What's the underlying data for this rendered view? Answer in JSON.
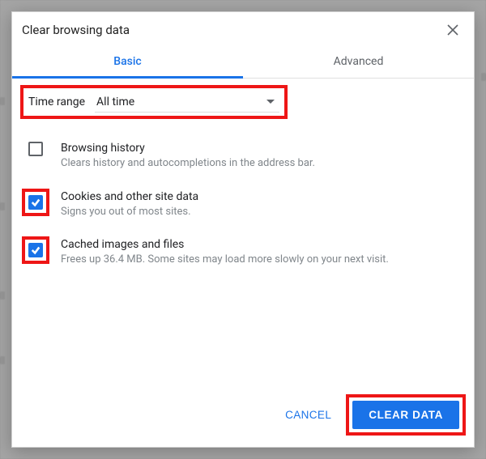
{
  "dialog": {
    "title": "Clear browsing data",
    "tabs": {
      "basic": "Basic",
      "advanced": "Advanced"
    },
    "time_range": {
      "label": "Time range",
      "value": "All time"
    },
    "options": [
      {
        "title": "Browsing history",
        "desc": "Clears history and autocompletions in the address bar.",
        "checked": false,
        "highlighted": false
      },
      {
        "title": "Cookies and other site data",
        "desc": "Signs you out of most sites.",
        "checked": true,
        "highlighted": true
      },
      {
        "title": "Cached images and files",
        "desc": "Frees up 36.4 MB. Some sites may load more slowly on your next visit.",
        "checked": true,
        "highlighted": true
      }
    ],
    "buttons": {
      "cancel": "CANCEL",
      "clear": "CLEAR DATA"
    }
  }
}
